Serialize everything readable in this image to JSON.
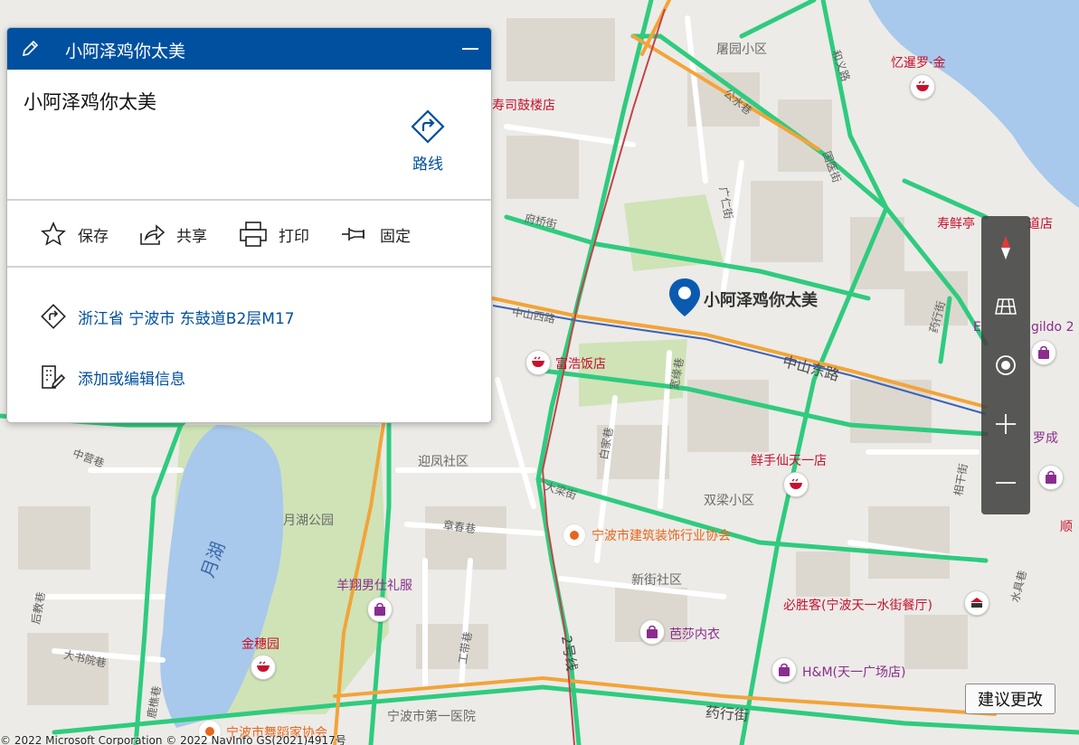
{
  "panel": {
    "header_title": "小阿泽鸡你太美",
    "place_name": "小阿泽鸡你太美",
    "route_label": "路线",
    "actions": {
      "save": "保存",
      "share": "共享",
      "print": "打印",
      "pin": "固定"
    },
    "address": "浙江省 宁波市 东鼓道B2层M17",
    "edit_info": "添加或编辑信息"
  },
  "map": {
    "pin_label": "小阿泽鸡你太美",
    "labels": {
      "tuyuan": "屠园小区",
      "yichiluojin": "忆暹罗·金",
      "shousi": "寿司鼓楼店",
      "gongshui": "公水巷",
      "heyi": "和义路",
      "guoyi": "国医街",
      "fuqiao": "府桥街",
      "guangren": "广仁街",
      "shouxianting": "寿鲜亭",
      "daodian": "道店",
      "yaohang_n": "药行街",
      "zhongshanxi": "中山西路",
      "fuhao": "富浩饭店",
      "zhongshandong": "中山东路",
      "kuanyan": "宽缘巷",
      "esprit": "E",
      "gildo": "gildo 2",
      "luocheng": "罗成",
      "zhongying": "中营巷",
      "yingfeng": "迎凤社区",
      "baijia": "白家巷",
      "xianshou": "鲜手仙天一店",
      "dalang": "大梁街",
      "shuangliang": "双梁小区",
      "xiangan": "相干街",
      "shun": "顺",
      "yuehu_park": "月湖公园",
      "zhangchun": "章春巷",
      "jianzhu": "宁波市建筑装饰行业协会",
      "yuehu_lake": "月湖",
      "xinjie": "新街社区",
      "yuxiang": "羊翔男仕礼服",
      "bishengke": "必胜客(宁波天一水街餐厅)",
      "shuijie": "水具巷",
      "houjiao": "后教巷",
      "yusha": "芭莎内衣",
      "jinsui": "金穗园",
      "dashu": "大书院巷",
      "gongxiang": "工带巷",
      "line2": "2号线",
      "hm": "H&M(天一广场店)",
      "ludiao": "鹿樵巷",
      "diyi": "宁波市第一医院",
      "yaohang_s": "药行街",
      "wuyan": "宁波市舞蹈家协会"
    }
  },
  "controls": {
    "compass": "compass",
    "layers": "layers",
    "locate": "locate",
    "zoom_in": "zoom-in",
    "zoom_out": "zoom-out"
  },
  "suggest_button": "建议更改",
  "copyright": "© 2022 Microsoft Corporation  © 2022 NavInfo GS(2021)4917号"
}
